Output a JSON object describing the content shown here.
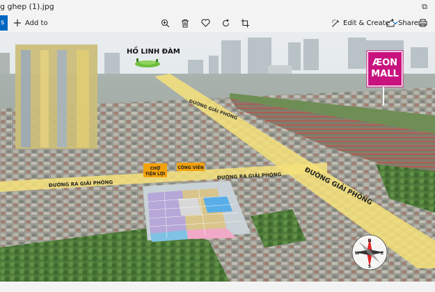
{
  "window": {
    "title": "g ghep (1).jpg",
    "restore_glyph": "⧉"
  },
  "toolbar": {
    "left_segment": "s",
    "add_to_label": "Add to",
    "edit_create_label": "Edit & Create",
    "share_label": "Share",
    "icons": [
      "zoom-in-icon",
      "delete-icon",
      "favorite-icon",
      "rotate-icon",
      "crop-icon",
      "edit-create-icon",
      "share-icon",
      "print-icon"
    ]
  },
  "photo": {
    "label_lake": "HỒ LINH ĐÀM",
    "label_aeon_1": "ÆON",
    "label_aeon_2": "MALL",
    "label_road_top": "ĐƯỜNG GIẢI PHÓNG",
    "label_road_main": "ĐƯỜNG GIẢI PHÓNG",
    "label_road_left": "ĐƯỜNG RA GIẢI PHÓNG",
    "label_road_mid": "ĐƯỜNG RA GIẢI PHÓNG",
    "label_market_1": "CHỢ",
    "label_market_2": "TIỆN LỢI",
    "label_park": "CÔNG VIÊN",
    "compass_n": "N",
    "compass_s": "S",
    "compass_e": "E",
    "compass_w": "W",
    "colors": {
      "road_highlight": "#f6e27a",
      "aeon_magenta": "#c8137f",
      "label_orange": "#f2a20c",
      "sky": "#dfe5e8"
    }
  }
}
